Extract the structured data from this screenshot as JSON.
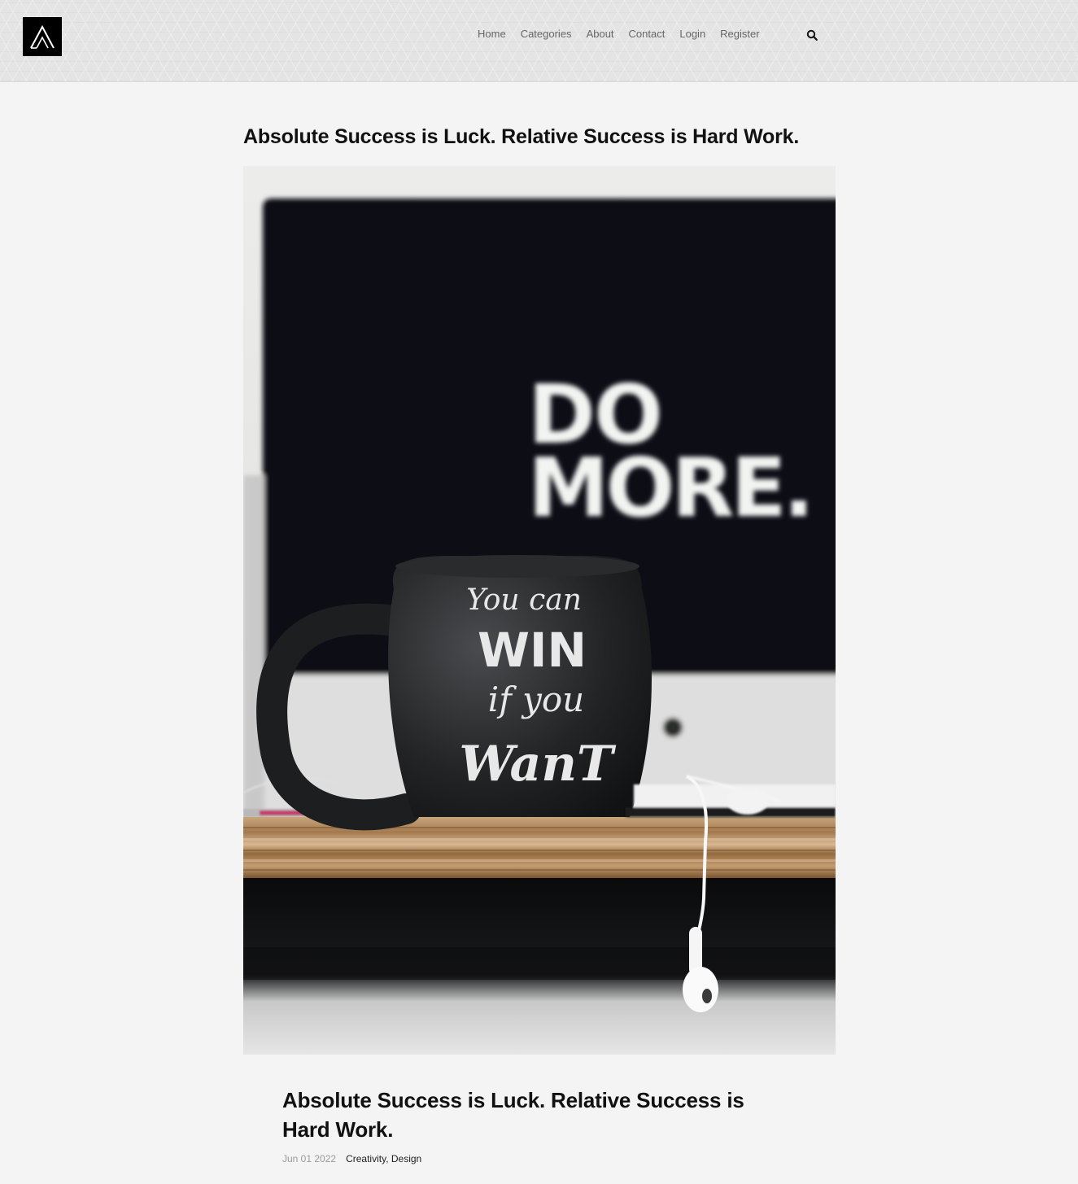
{
  "header": {
    "nav": {
      "home": "Home",
      "categories": "Categories",
      "about": "About",
      "contact": "Contact",
      "login": "Login",
      "register": "Register"
    },
    "search_icon": "search-icon",
    "logo_icon": "triangle-logo-icon"
  },
  "post": {
    "title": "Absolute Success is Luck. Relative Success is Hard Work.",
    "card_title": "Absolute Success is Luck. Relative Success is Hard Work.",
    "date": "Jun 01 2022",
    "categories": [
      "Creativity",
      "Design"
    ],
    "category_separator": ",",
    "image": {
      "screen_text_line1": "DO",
      "screen_text_line2": "MORE.",
      "mug_text_line1": "You can",
      "mug_text_line2": "WIN",
      "mug_text_line3": "if you",
      "mug_text_line4": "WanT"
    }
  },
  "colors": {
    "header_bg": "#e4e4e4",
    "page_bg": "#f4f4f4",
    "text": "#111111",
    "nav_text": "#666666",
    "meta_date": "#9a9a9a"
  }
}
